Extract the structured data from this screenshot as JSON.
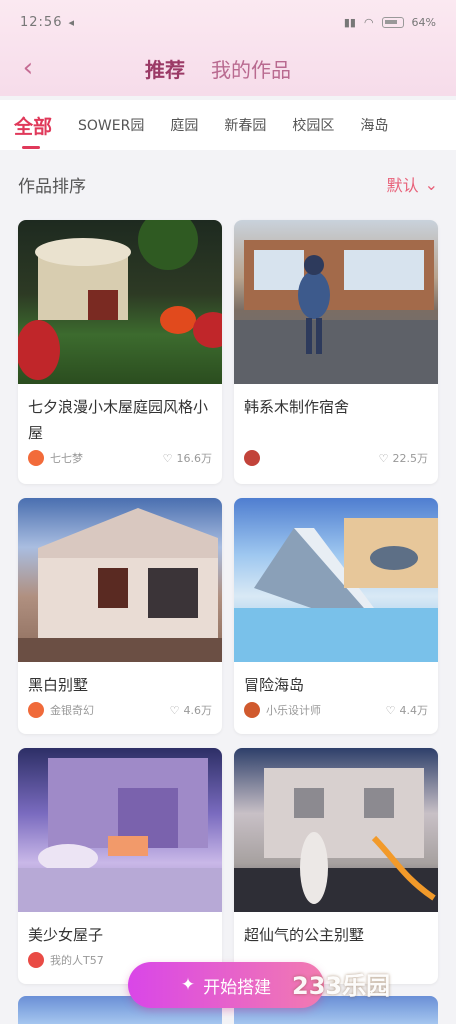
{
  "status_bar": {
    "time": "12:56",
    "battery": "64%"
  },
  "header": {
    "tabs": [
      {
        "label": "推荐",
        "active": true
      },
      {
        "label": "我的作品",
        "active": false
      }
    ]
  },
  "categories": [
    {
      "label": "全部",
      "active": true
    },
    {
      "label": "SOWER园",
      "active": false
    },
    {
      "label": "庭园",
      "active": false
    },
    {
      "label": "新春园",
      "active": false
    },
    {
      "label": "校园区",
      "active": false
    },
    {
      "label": "海岛",
      "active": false
    }
  ],
  "sort": {
    "title": "作品排序",
    "selected": "默认"
  },
  "cards": [
    {
      "title": "七夕浪漫小木屋庭园风格小屋",
      "author": "七七梦",
      "likes": "16.6万"
    },
    {
      "title": "韩系木制作宿舍",
      "author": "",
      "likes": "22.5万"
    },
    {
      "title": "黑白别墅",
      "author": "金银奇幻",
      "likes": "4.6万"
    },
    {
      "title": "冒险海岛",
      "author": "小乐设计师",
      "likes": "4.4万"
    },
    {
      "title": "美少女屋子",
      "author": "我的人T57",
      "likes": ""
    },
    {
      "title": "超仙气的公主别墅",
      "author": "",
      "likes": ""
    }
  ],
  "fab": {
    "label": "开始搭建"
  },
  "watermark": "233乐园",
  "colors": {
    "accent": "#e0395a",
    "header_bg": "#f9e3ee",
    "fab_start": "#d946e8",
    "fab_end": "#f27bb0"
  }
}
